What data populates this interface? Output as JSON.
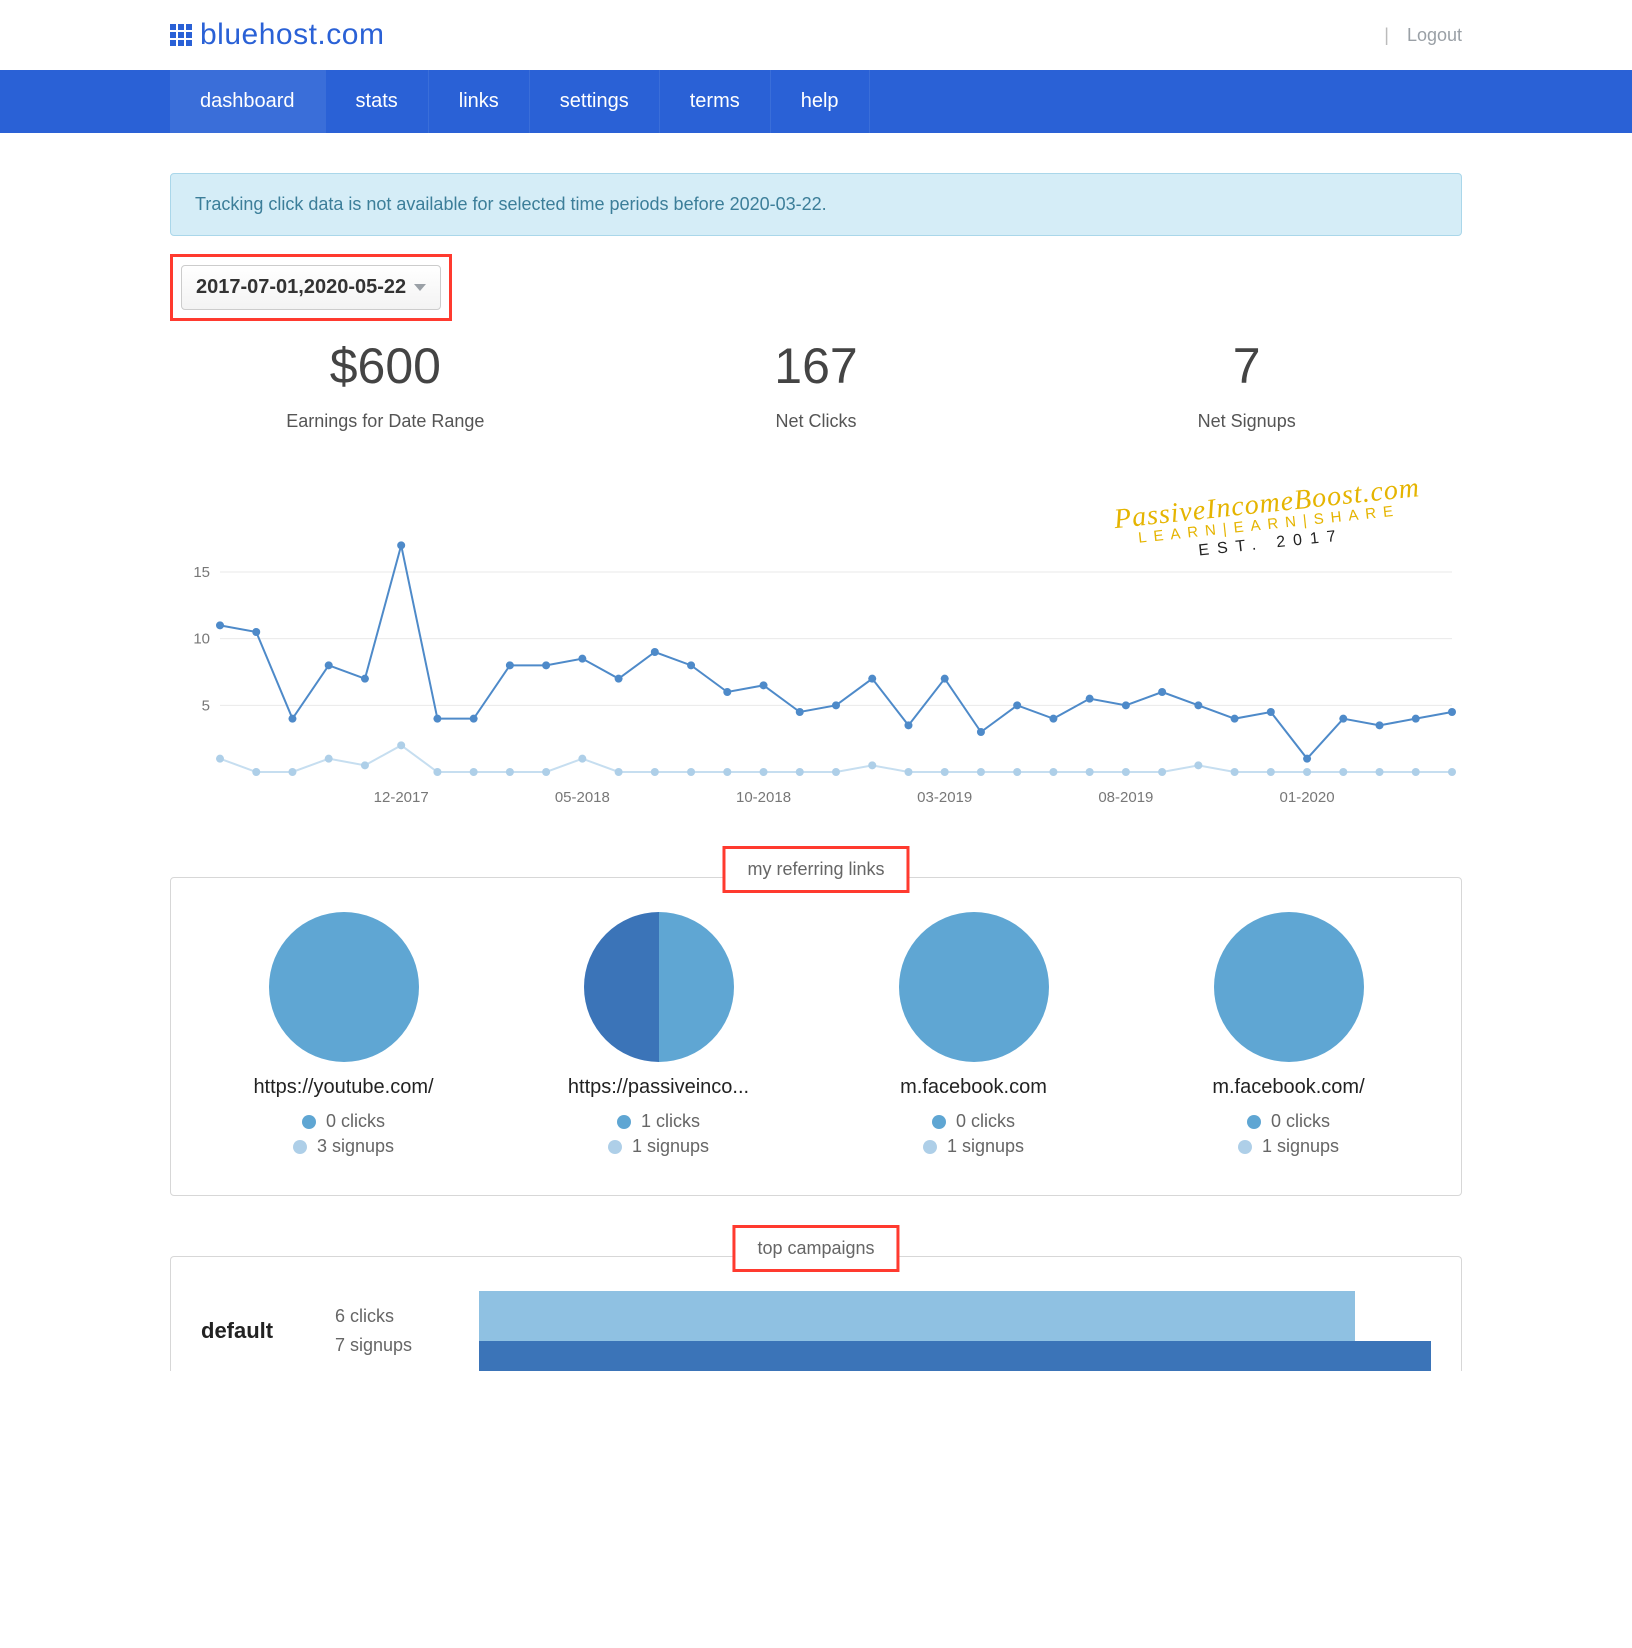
{
  "header": {
    "brand": "bluehost.com",
    "logout": "Logout"
  },
  "nav": {
    "items": [
      "dashboard",
      "stats",
      "links",
      "settings",
      "terms",
      "help"
    ],
    "active_index": 0
  },
  "notice": "Tracking click data is not available for selected time periods before 2020-03-22.",
  "date_range": "2017-07-01,2020-05-22",
  "summary": {
    "earnings": {
      "value": "$600",
      "label": "Earnings for Date Range"
    },
    "clicks": {
      "value": "167",
      "label": "Net Clicks"
    },
    "signups": {
      "value": "7",
      "label": "Net Signups"
    }
  },
  "watermark": {
    "line1": "PassiveIncomeBoost.com",
    "line2": "LEARN|EARN|SHARE",
    "line3": "EST. 2017"
  },
  "chart_data": {
    "type": "line",
    "ylim": [
      0,
      18
    ],
    "yticks": [
      5,
      10,
      15
    ],
    "x_tick_labels": [
      "12-2017",
      "05-2018",
      "10-2018",
      "03-2019",
      "08-2019",
      "01-2020"
    ],
    "x_tick_indices": [
      5,
      10,
      15,
      20,
      25,
      30
    ],
    "series": [
      {
        "name": "Net Clicks",
        "color": "#4e8ac9",
        "values": [
          11,
          10.5,
          4,
          8,
          7,
          17,
          4,
          4,
          8,
          8,
          8.5,
          7,
          9,
          8,
          6,
          6.5,
          4.5,
          5,
          7,
          3.5,
          7,
          3,
          5,
          4,
          5.5,
          5,
          6,
          5,
          4,
          4.5,
          1,
          4,
          3.5,
          4,
          4.5
        ]
      },
      {
        "name": "Net Signups",
        "color": "#aecfe8",
        "values": [
          1,
          0,
          0,
          1,
          0.5,
          2,
          0,
          0,
          0,
          0,
          1,
          0,
          0,
          0,
          0,
          0,
          0,
          0,
          0.5,
          0,
          0,
          0,
          0,
          0,
          0,
          0,
          0,
          0.5,
          0,
          0,
          0,
          0,
          0,
          0,
          0
        ]
      }
    ]
  },
  "referring": {
    "title": "my referring links",
    "links": [
      {
        "url": "https://youtube.com/",
        "clicks": 0,
        "signups": 3,
        "pie": "full"
      },
      {
        "url": "https://passiveinco...",
        "clicks": 1,
        "signups": 1,
        "pie": "half"
      },
      {
        "url": "m.facebook.com",
        "clicks": 0,
        "signups": 1,
        "pie": "full"
      },
      {
        "url": "m.facebook.com/",
        "clicks": 0,
        "signups": 1,
        "pie": "full"
      }
    ]
  },
  "campaigns": {
    "title": "top campaigns",
    "rows": [
      {
        "name": "default",
        "clicks": 6,
        "signups": 7,
        "bar_clicks_pct": 92,
        "bar_signups_pct": 100
      }
    ]
  },
  "labels": {
    "clicks_suffix": " clicks",
    "signups_suffix": " signups"
  }
}
